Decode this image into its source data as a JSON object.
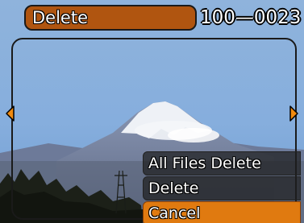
{
  "header": {
    "mode_label": "Delete",
    "file_number": "100—0023"
  },
  "menu": {
    "items": [
      {
        "label": "All Files Delete"
      },
      {
        "label": "Delete"
      },
      {
        "label": "Cancel"
      }
    ],
    "selected_index": 2
  },
  "navigation": {
    "prev_icon": "arrow-left-icon",
    "next_icon": "arrow-right-icon"
  },
  "colors": {
    "label_background": "#b05510",
    "menu_highlight": "#e07a10",
    "arrow": "#f08a10"
  }
}
